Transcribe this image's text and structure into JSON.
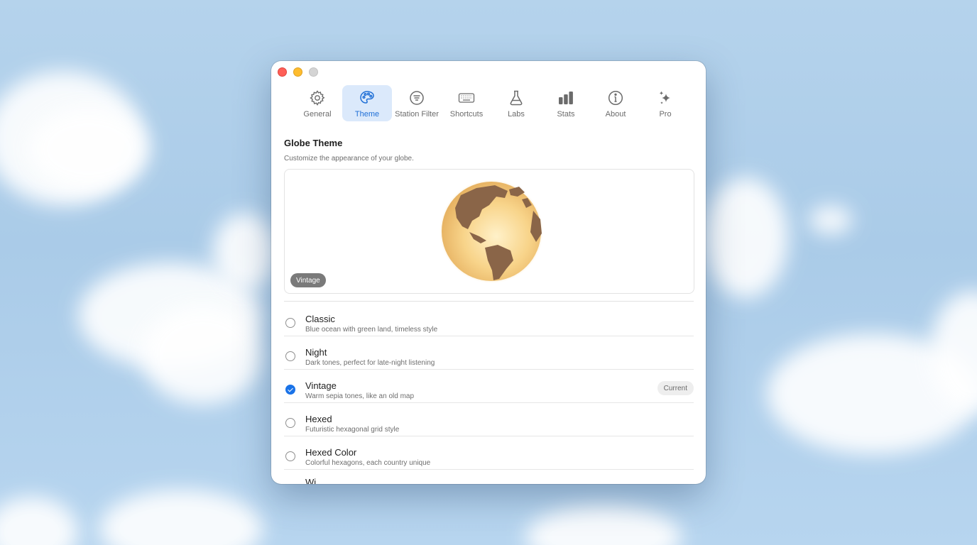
{
  "toolbar": {
    "tabs": [
      {
        "label": "General",
        "icon": "gear-icon"
      },
      {
        "label": "Theme",
        "icon": "palette-icon",
        "active": true
      },
      {
        "label": "Station Filter",
        "icon": "filter-list-icon"
      },
      {
        "label": "Shortcuts",
        "icon": "keyboard-icon"
      },
      {
        "label": "Labs",
        "icon": "flask-icon"
      },
      {
        "label": "Stats",
        "icon": "bar-chart-icon"
      },
      {
        "label": "About",
        "icon": "info-icon"
      },
      {
        "label": "Pro",
        "icon": "sparkles-icon"
      }
    ]
  },
  "section": {
    "title": "Globe Theme",
    "subtitle": "Customize the appearance of your globe."
  },
  "preview": {
    "theme_label": "Vintage"
  },
  "themes": [
    {
      "name": "Classic",
      "description": "Blue ocean with green land, timeless style",
      "selected": false
    },
    {
      "name": "Night",
      "description": "Dark tones, perfect for late-night listening",
      "selected": false
    },
    {
      "name": "Vintage",
      "description": "Warm sepia tones, like an old map",
      "selected": true,
      "badge": "Current"
    },
    {
      "name": "Hexed",
      "description": "Futuristic hexagonal grid style",
      "selected": false
    },
    {
      "name": "Hexed Color",
      "description": "Colorful hexagons, each country unique",
      "selected": false
    },
    {
      "name": "Wi..."
    }
  ],
  "colors": {
    "accent": "#1a73e8",
    "active_tab_bg": "#dbe9fb",
    "active_tab_text": "#1f6fd6"
  }
}
